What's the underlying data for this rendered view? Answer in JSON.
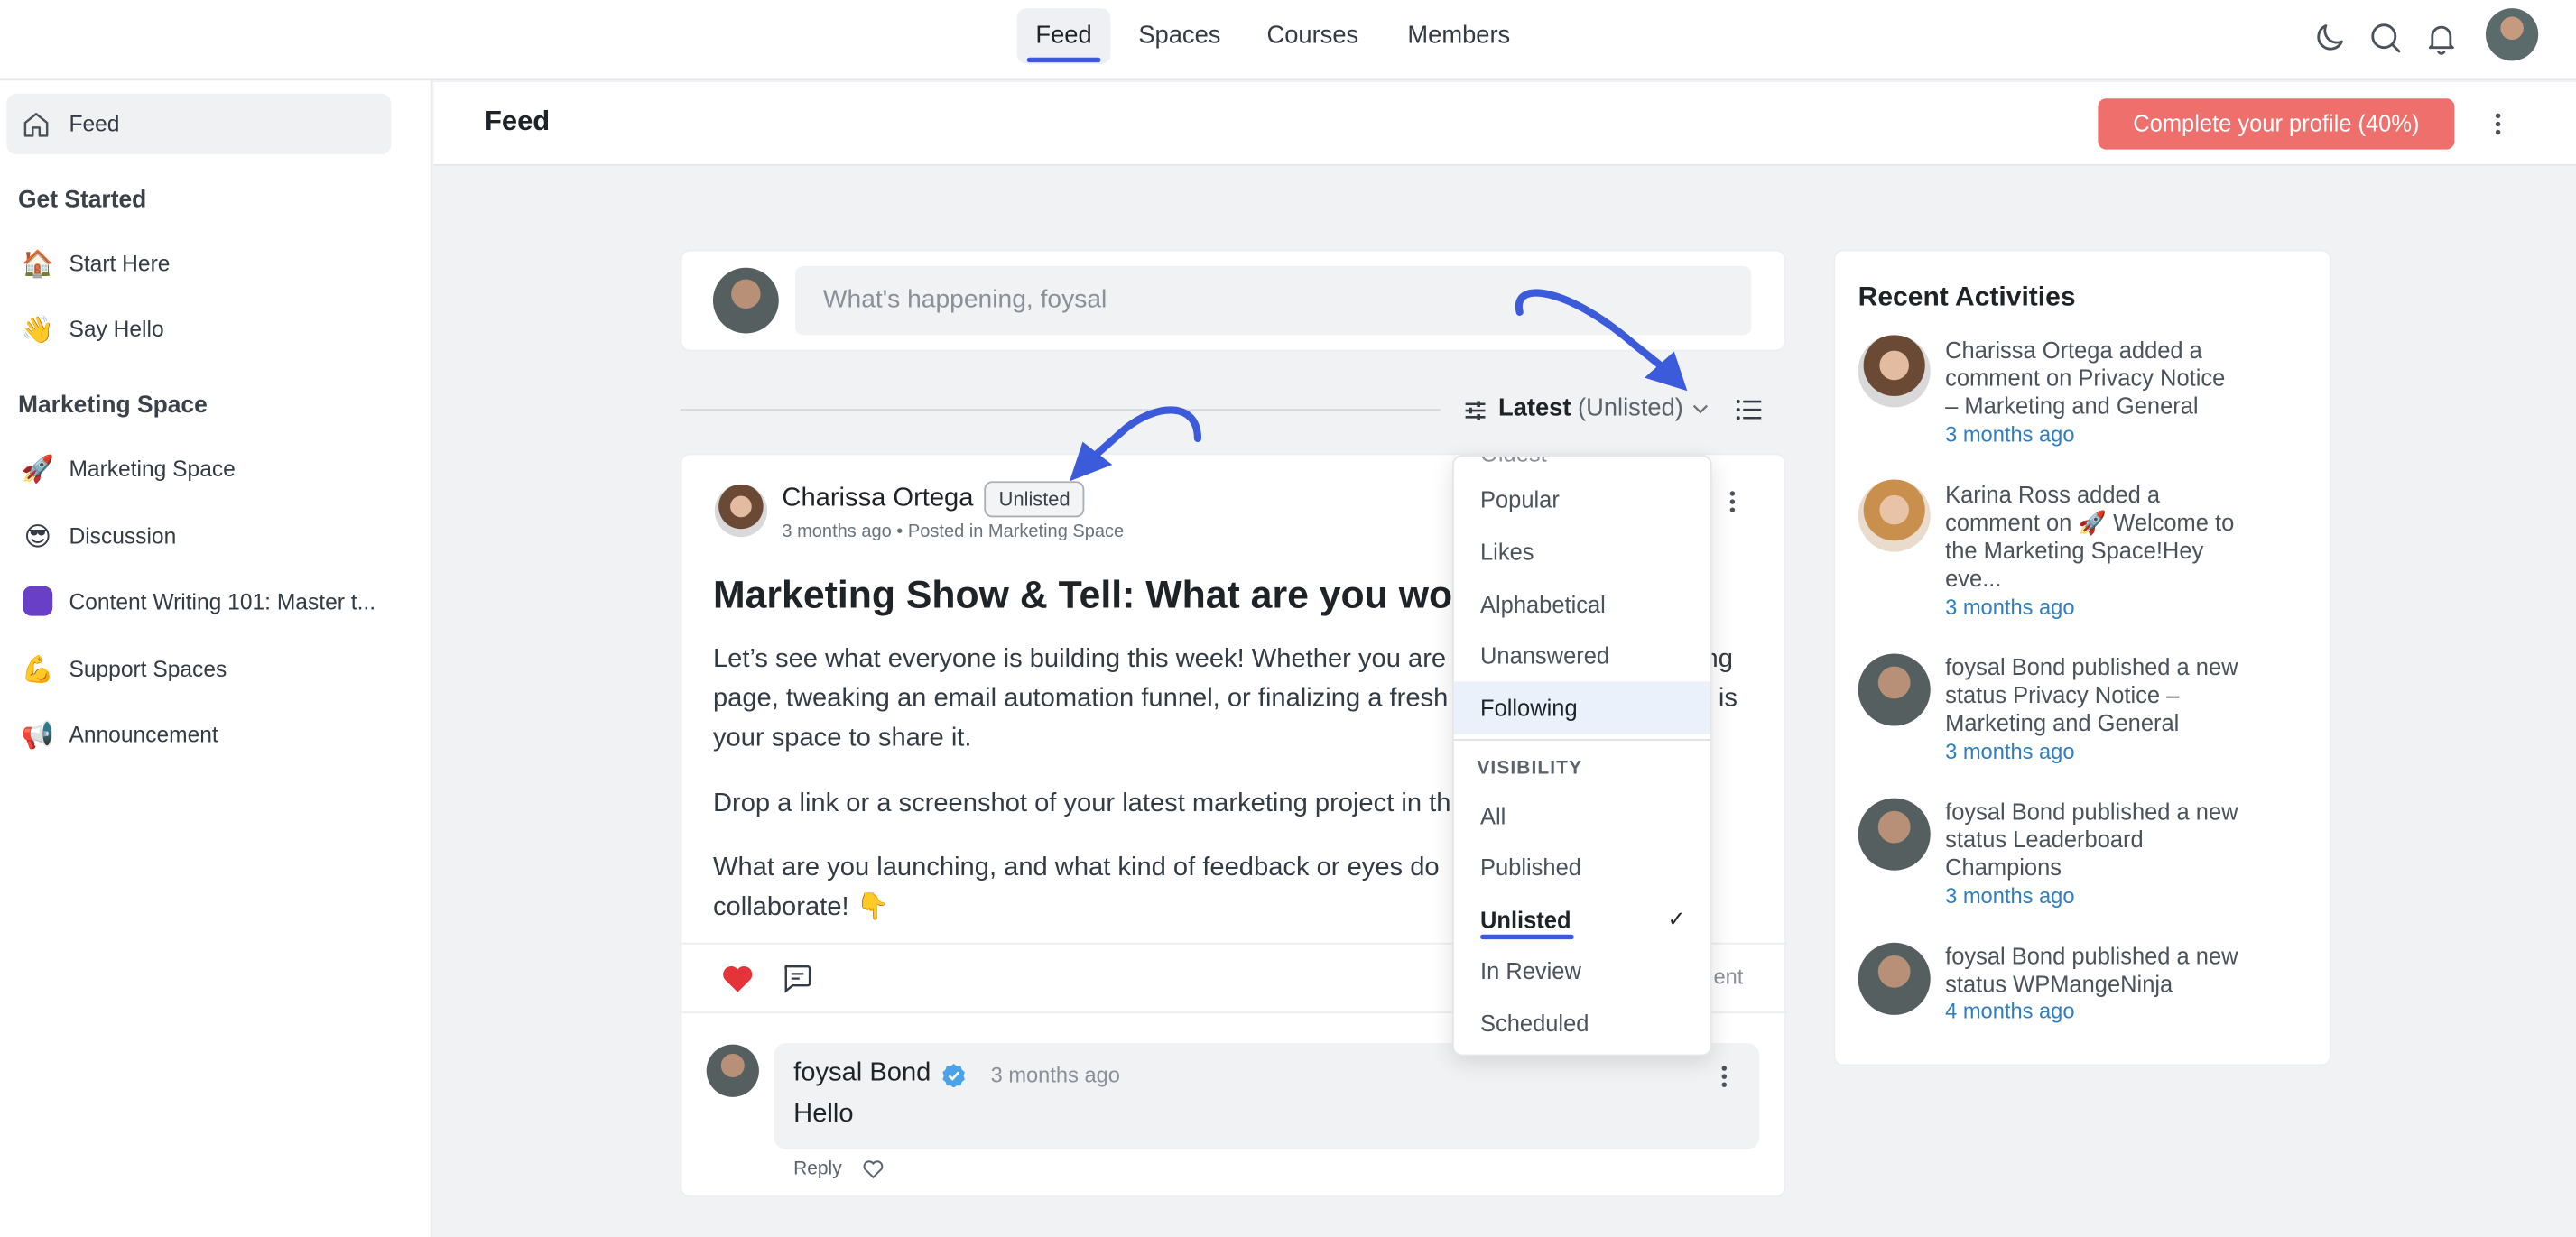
{
  "topnav": {
    "tabs": [
      {
        "label": "Feed",
        "active": true
      },
      {
        "label": "Spaces"
      },
      {
        "label": "Courses"
      },
      {
        "label": "Members"
      }
    ],
    "icons": [
      "moon-icon",
      "search-icon",
      "bell-icon",
      "avatar"
    ]
  },
  "sidebar": {
    "feed_label": "Feed",
    "get_started_heading": "Get Started",
    "get_started_items": [
      {
        "emoji": "🏠",
        "label": "Start Here"
      },
      {
        "emoji": "👋",
        "label": "Say Hello"
      }
    ],
    "marketing_heading": "Marketing Space",
    "marketing_items": [
      {
        "emoji": "🚀",
        "label": "Marketing Space"
      },
      {
        "emoji": "😎",
        "label": "Discussion"
      },
      {
        "emoji": "",
        "label": "Content Writing 101: Master t..."
      },
      {
        "emoji": "💪",
        "label": "Support Spaces"
      },
      {
        "emoji": "📢",
        "label": "Announcement"
      }
    ]
  },
  "header": {
    "title": "Feed",
    "cta": "Complete your profile (40%)"
  },
  "composer": {
    "placeholder": "What's happening, foysal"
  },
  "sort": {
    "label": "Latest",
    "qualifier": "(Unlisted)"
  },
  "dropdown": {
    "sort_options": [
      "Popular",
      "Likes",
      "Alphabetical",
      "Unanswered",
      "Following"
    ],
    "highlighted": "Following",
    "visibility_heading": "VISIBILITY",
    "visibility_options": [
      "All",
      "Published",
      "Unlisted",
      "In Review",
      "Scheduled"
    ],
    "selected_visibility": "Unlisted"
  },
  "post": {
    "author": "Charissa Ortega",
    "badge": "Unlisted",
    "meta": "3 months ago • Posted in Marketing Space",
    "title": "Marketing Show & Tell: What are you work",
    "body_1": "Let’s see what everyone is building this week! Whether you are",
    "body_1_tail": "ng",
    "body_2": "page, tweaking an email automation funnel, or finalizing a fresh",
    "body_2_tail": "is",
    "body_3": "your space to share it.",
    "body_4": "Drop a link or a screenshot of your latest marketing project in th",
    "body_5": "What are you launching, and what kind of feedback or eyes do",
    "body_6": "collaborate! 👇",
    "action_tail": "ent"
  },
  "comment": {
    "author": "foysal Bond",
    "time": "3 months ago",
    "text": "Hello",
    "reply": "Reply"
  },
  "recent": {
    "heading": "Recent Activities",
    "items": [
      {
        "avatar": "female",
        "lines": [
          "Charissa Ortega added a",
          "comment on Privacy Notice",
          "– Marketing and General"
        ],
        "time": "3 months ago"
      },
      {
        "avatar": "female2",
        "lines": [
          "Karina Ross added a",
          "comment on 🚀 Welcome to",
          "the Marketing Space!Hey",
          "eve..."
        ],
        "time": "3 months ago"
      },
      {
        "avatar": "male",
        "lines": [
          "foysal Bond published a new",
          "status Privacy Notice –",
          "Marketing and General"
        ],
        "time": "3 months ago"
      },
      {
        "avatar": "male",
        "lines": [
          "foysal Bond published a new",
          "status Leaderboard",
          "Champions"
        ],
        "time": "3 months ago"
      },
      {
        "avatar": "male",
        "lines": [
          "foysal Bond published a new",
          "status WPMangeNinja"
        ],
        "time": "4 months ago"
      }
    ]
  },
  "colors": {
    "accent": "#3b5bdb",
    "cta": "#ef6f6c",
    "link": "#2f7dc2",
    "heart": "#e5333a"
  }
}
